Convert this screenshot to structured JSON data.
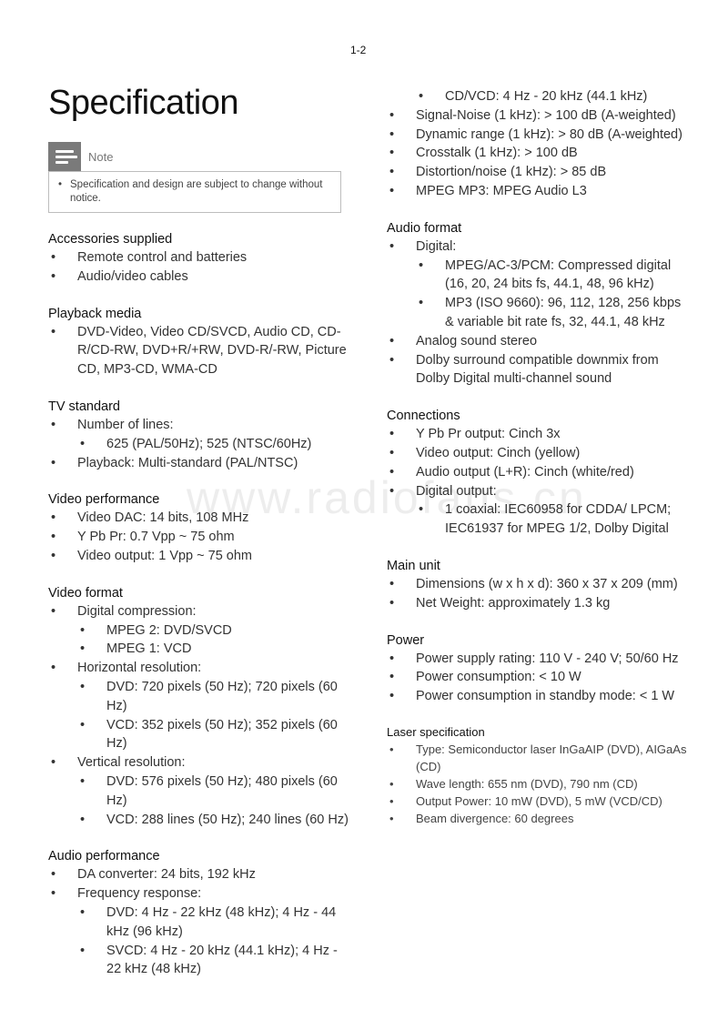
{
  "page_number": "1-2",
  "watermark": "www.radiofans.cn",
  "title": "Specification",
  "note": {
    "label": "Note",
    "icon": "note-icon",
    "items": [
      "Specification and design are subject to change without notice."
    ]
  },
  "bullet": "•",
  "left_column": [
    {
      "title": "Accessories supplied",
      "items": [
        {
          "text": "Remote control and batteries"
        },
        {
          "text": "Audio/video cables"
        }
      ]
    },
    {
      "title": "Playback media",
      "items": [
        {
          "text": "DVD-Video, Video CD/SVCD, Audio CD, CD-R/CD-RW, DVD+R/+RW, DVD-R/-RW, Picture CD, MP3-CD, WMA-CD"
        }
      ]
    },
    {
      "title": "TV standard",
      "items": [
        {
          "text": "Number of lines:",
          "sub": [
            "625 (PAL/50Hz); 525 (NTSC/60Hz)"
          ]
        },
        {
          "text": "Playback: Multi-standard (PAL/NTSC)"
        }
      ]
    },
    {
      "title": "Video performance",
      "items": [
        {
          "text": "Video DAC: 14 bits, 108 MHz"
        },
        {
          "text": "Y Pb Pr: 0.7 Vpp ~ 75 ohm"
        },
        {
          "text": "Video output: 1 Vpp ~ 75 ohm"
        }
      ]
    },
    {
      "title": "Video format",
      "items": [
        {
          "text": "Digital compression:",
          "sub": [
            "MPEG 2: DVD/SVCD",
            "MPEG 1: VCD"
          ]
        },
        {
          "text": "Horizontal resolution:",
          "sub": [
            "DVD: 720 pixels (50 Hz); 720 pixels (60 Hz)",
            "VCD: 352 pixels (50 Hz); 352 pixels (60 Hz)"
          ]
        },
        {
          "text": "Vertical resolution:",
          "sub": [
            "DVD: 576 pixels (50 Hz); 480 pixels (60 Hz)",
            "VCD: 288 lines (50 Hz); 240 lines (60 Hz)"
          ]
        }
      ]
    },
    {
      "title": "Audio performance",
      "items": [
        {
          "text": "DA converter: 24 bits, 192 kHz"
        },
        {
          "text": "Frequency response:",
          "sub": [
            "DVD: 4 Hz - 22 kHz (48 kHz); 4 Hz - 44 kHz (96 kHz)",
            "SVCD: 4 Hz - 20 kHz (44.1 kHz); 4 Hz - 22 kHz (48 kHz)"
          ]
        }
      ]
    }
  ],
  "right_column": [
    {
      "title": "",
      "items": [
        {
          "text": "",
          "sub": [
            "CD/VCD: 4 Hz - 20 kHz (44.1 kHz)"
          ]
        },
        {
          "text": "Signal-Noise (1 kHz): > 100 dB (A-weighted)"
        },
        {
          "text": "Dynamic range (1 kHz): > 80 dB (A-weighted)"
        },
        {
          "text": "Crosstalk (1 kHz): > 100 dB"
        },
        {
          "text": "Distortion/noise (1 kHz): > 85 dB"
        },
        {
          "text": "MPEG MP3: MPEG Audio L3"
        }
      ]
    },
    {
      "title": "Audio format",
      "items": [
        {
          "text": "Digital:",
          "sub": [
            "MPEG/AC-3/PCM: Compressed digital (16, 20, 24 bits fs, 44.1, 48, 96 kHz)",
            "MP3 (ISO 9660): 96, 112, 128, 256 kbps & variable bit rate fs, 32, 44.1, 48 kHz"
          ]
        },
        {
          "text": "Analog sound stereo"
        },
        {
          "text": "Dolby surround compatible downmix from Dolby Digital multi-channel sound"
        }
      ]
    },
    {
      "title": "Connections",
      "items": [
        {
          "text": "Y Pb Pr output: Cinch 3x"
        },
        {
          "text": "Video output: Cinch (yellow)"
        },
        {
          "text": "Audio output (L+R): Cinch (white/red)"
        },
        {
          "text": "Digital output:",
          "sub": [
            "1 coaxial: IEC60958 for CDDA/ LPCM; IEC61937 for MPEG 1/2, Dolby Digital"
          ]
        }
      ]
    },
    {
      "title": "Main unit",
      "items": [
        {
          "text": "Dimensions (w x h x d): 360 x 37 x 209 (mm)"
        },
        {
          "text": "Net Weight: approximately 1.3 kg"
        }
      ]
    },
    {
      "title": "Power",
      "items": [
        {
          "text": "Power supply rating: 110 V - 240 V; 50/60 Hz"
        },
        {
          "text": "Power consumption: < 10 W"
        },
        {
          "text": "Power consumption in standby mode: < 1 W"
        }
      ]
    },
    {
      "title": "Laser specification",
      "small": true,
      "items": [
        {
          "text": "Type: Semiconductor laser InGaAIP (DVD), AIGaAs (CD)"
        },
        {
          "text": "Wave length: 655 nm (DVD), 790 nm (CD)"
        },
        {
          "text": "Output Power: 10 mW (DVD), 5 mW (VCD/CD)"
        },
        {
          "text": "Beam divergence: 60 degrees"
        }
      ]
    }
  ]
}
